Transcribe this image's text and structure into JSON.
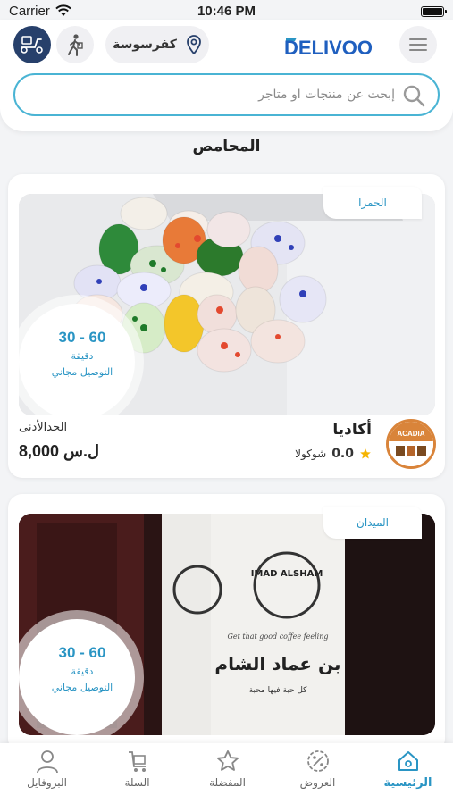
{
  "status_bar": {
    "carrier": "Carrier",
    "time": "10:46 PM"
  },
  "header": {
    "location": "كفرسوسة",
    "logo_text": "DELIVOO",
    "search_placeholder": "إبحث عن منتجات أو متاجر"
  },
  "section_title": "المحامص",
  "stores": [
    {
      "area": "الحمرا",
      "name": "أكاديا",
      "rating": "0.0",
      "category": "شوكولا",
      "logo_text": "ACADIA",
      "eta_range": "30 - 60",
      "eta_unit": "دقيقة",
      "delivery": "التوصيل مجاني",
      "min_label": "الحدالأدنى",
      "min_value": "8,000 ل.س"
    },
    {
      "area": "الميدان",
      "eta_range": "30 - 60",
      "eta_unit": "دقيقة",
      "delivery": "التوصيل مجاني",
      "product_text_1": "IMAD ALSHAM",
      "product_text_2": "بن عماد الشام",
      "product_text_3": "كل حبة فيها محبة",
      "product_text_4": "Get that good coffee feeling"
    }
  ],
  "tabs": [
    {
      "label": "البروفايل",
      "icon": "profile-icon"
    },
    {
      "label": "السلة",
      "icon": "cart-icon"
    },
    {
      "label": "المفضلة",
      "icon": "star-icon"
    },
    {
      "label": "العروض",
      "icon": "percent-icon"
    },
    {
      "label": "الرئيسية",
      "icon": "home-icon",
      "active": true
    }
  ],
  "colors": {
    "accent": "#2a95c4",
    "brand": "#1f5fbf",
    "dark": "#27406b"
  }
}
